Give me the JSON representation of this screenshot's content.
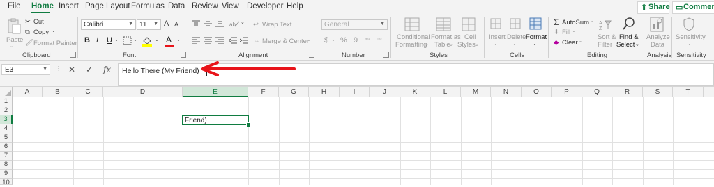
{
  "menu": {
    "items": [
      "File",
      "Home",
      "Insert",
      "Page Layout",
      "Formulas",
      "Data",
      "Review",
      "View",
      "Developer",
      "Help"
    ],
    "active": "Home",
    "share_label": "Share",
    "comments_label": "Comments"
  },
  "ribbon": {
    "clipboard": {
      "paste": "Paste",
      "cut": "Cut",
      "copy": "Copy",
      "format_painter": "Format Painter",
      "group_label": "Clipboard"
    },
    "font": {
      "font_name": "Calibri",
      "font_size": "11",
      "bold": "B",
      "italic": "I",
      "underline": "U",
      "grow": "A",
      "shrink": "A",
      "font_color_letter": "A",
      "group_label": "Font"
    },
    "alignment": {
      "wrap_text": "Wrap Text",
      "merge_center": "Merge & Center",
      "group_label": "Alignment"
    },
    "number": {
      "format": "General",
      "currency": "$",
      "percent": "%",
      "comma": "9",
      "group_label": "Number"
    },
    "styles": {
      "conditional": "Conditional",
      "formatting": "Formatting",
      "format_as": "Format as",
      "table": "Table",
      "cell": "Cell",
      "cell_styles": "Styles",
      "group_label": "Styles"
    },
    "cells": {
      "insert": "Insert",
      "delete": "Delete",
      "format": "Format",
      "group_label": "Cells"
    },
    "editing": {
      "autosum": "AutoSum",
      "fill": "Fill",
      "clear": "Clear",
      "sort": "Sort &",
      "filter": "Filter",
      "find": "Find &",
      "select": "Select",
      "group_label": "Editing"
    },
    "analysis": {
      "analyze": "Analyze",
      "data": "Data",
      "group_label": "Analysis"
    },
    "sensitivity": {
      "label": "Sensitivity",
      "group_label": "Sensitivity"
    }
  },
  "formula_bar": {
    "name_box": "E3",
    "cancel": "✕",
    "enter": "✓",
    "fx": "fx",
    "content": "Hello There (My Friend)"
  },
  "sheet": {
    "columns": [
      "A",
      "B",
      "C",
      "D",
      "E",
      "F",
      "G",
      "H",
      "I",
      "J",
      "K",
      "L",
      "M",
      "N",
      "O",
      "P",
      "Q",
      "R",
      "S",
      "T"
    ],
    "rows": [
      "1",
      "2",
      "3",
      "4",
      "5",
      "6",
      "7",
      "8",
      "9",
      "10"
    ],
    "active_cell": "E3",
    "active_cell_value": "Friend)"
  },
  "annotation": {
    "arrow_color": "#e8141a"
  },
  "colors": {
    "accent": "#107c41"
  }
}
